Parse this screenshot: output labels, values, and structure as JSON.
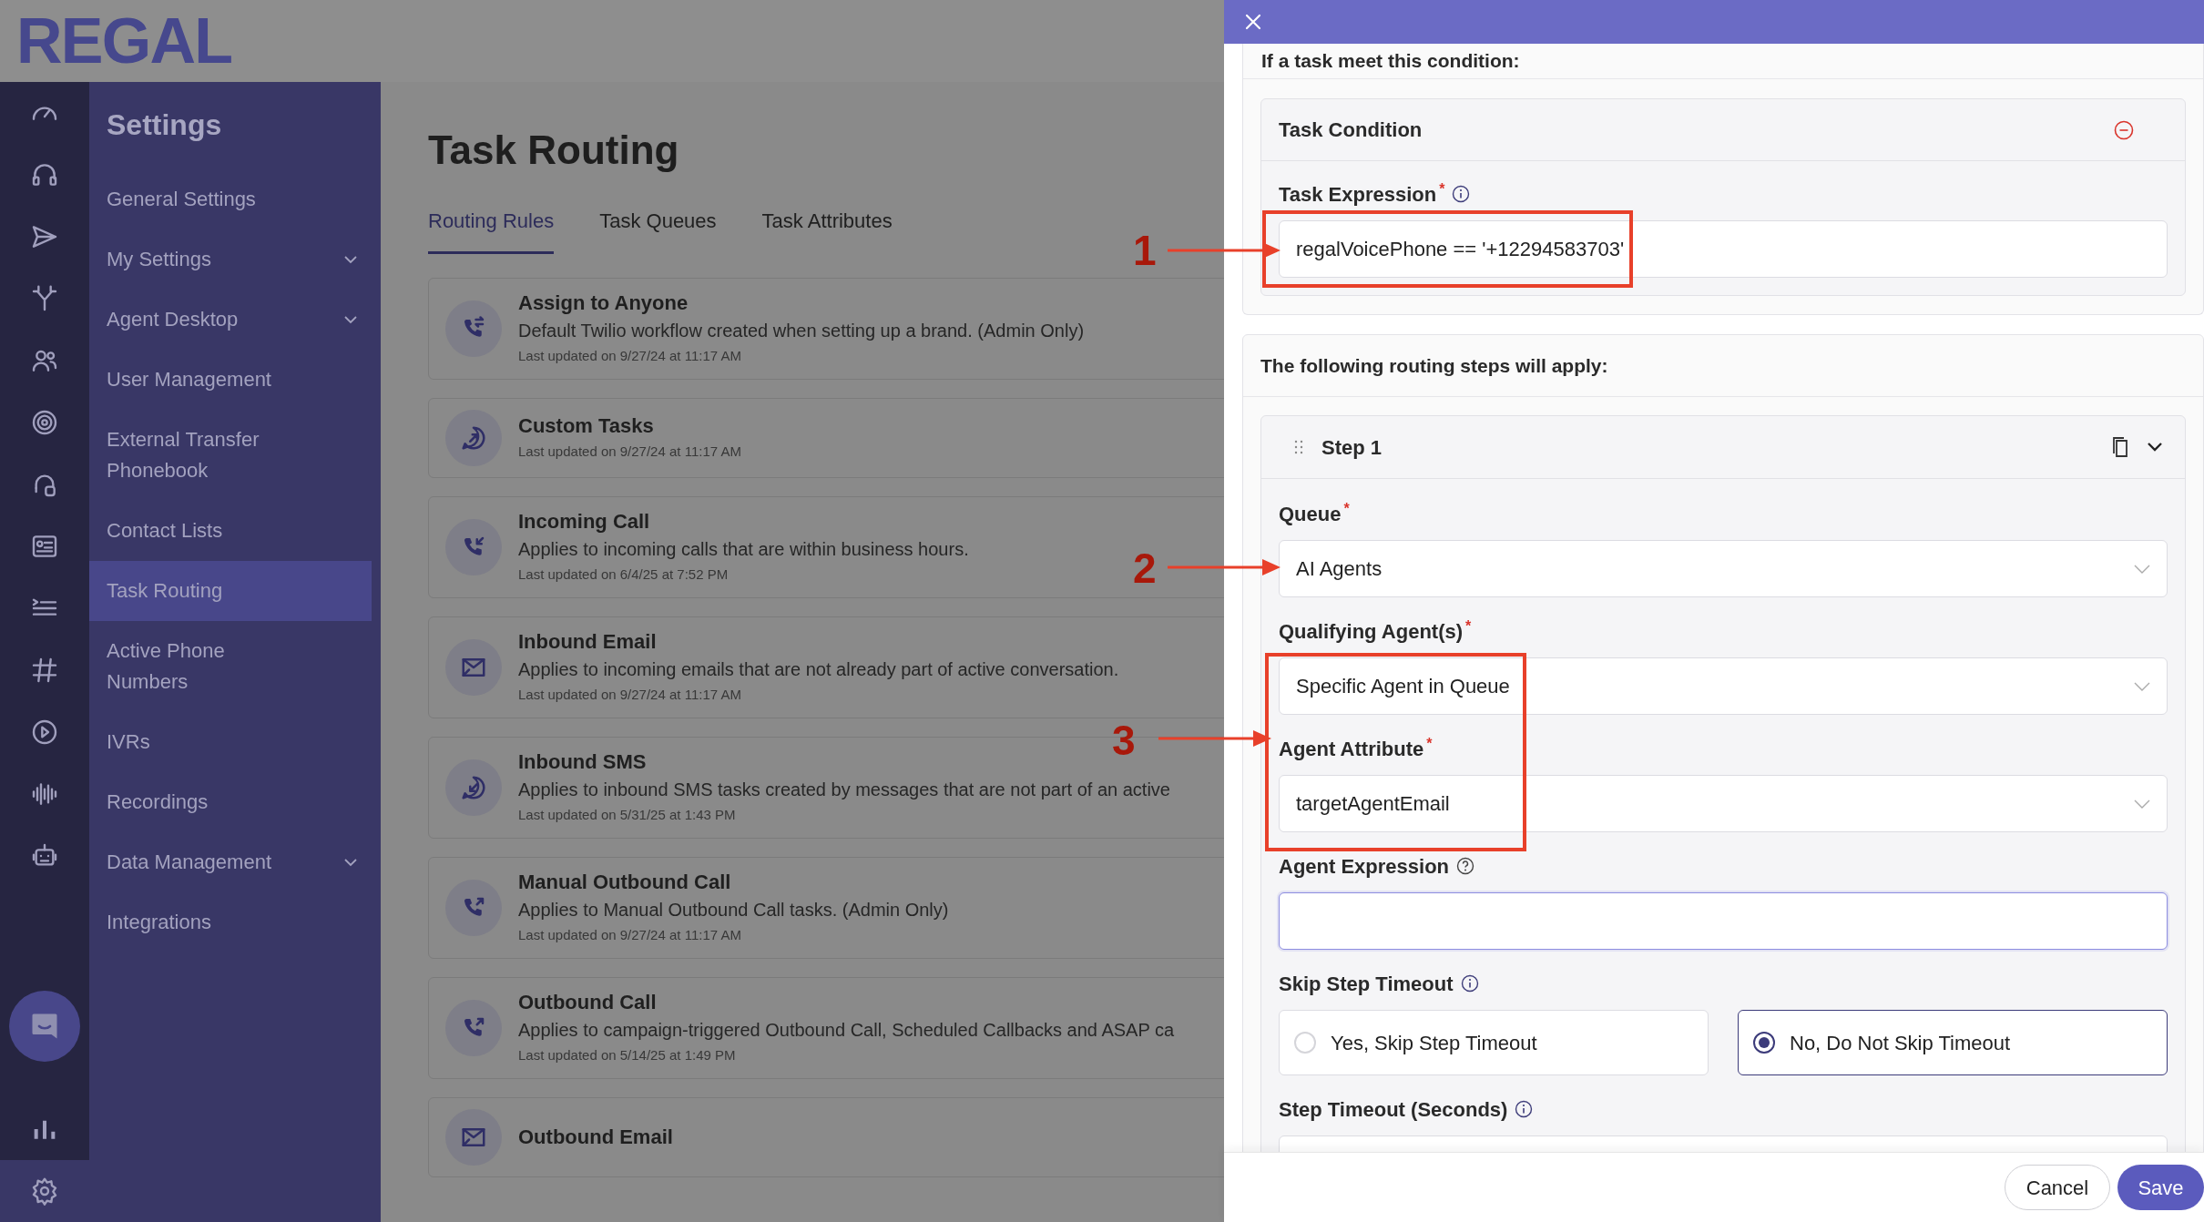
{
  "logo": "REGAL",
  "rail": {
    "top": [
      {
        "selected": false
      },
      {
        "selected": false
      },
      {
        "selected": false
      },
      {
        "selected": false
      },
      {
        "selected": false
      },
      {
        "selected": false
      },
      {
        "selected": false
      },
      {
        "selected": false
      },
      {
        "selected": false
      },
      {
        "selected": false
      },
      {
        "selected": false
      },
      {
        "selected": false
      },
      {
        "selected": false
      }
    ],
    "bottom": [
      {
        "selected": false
      },
      {
        "selected": true
      }
    ]
  },
  "sidebar": {
    "title": "Settings",
    "items": [
      {
        "label": "General Settings",
        "selected": false,
        "has_submenu": false
      },
      {
        "label": "My Settings",
        "selected": false,
        "has_submenu": true
      },
      {
        "label": "Agent Desktop",
        "selected": false,
        "has_submenu": true
      },
      {
        "label": "User Management",
        "selected": false,
        "has_submenu": false
      },
      {
        "label": "External Transfer Phonebook",
        "selected": false,
        "has_submenu": false
      },
      {
        "label": "Contact Lists",
        "selected": false,
        "has_submenu": false
      },
      {
        "label": "Task Routing",
        "selected": true,
        "has_submenu": false
      },
      {
        "label": "Active Phone Numbers",
        "selected": false,
        "has_submenu": false
      },
      {
        "label": "IVRs",
        "selected": false,
        "has_submenu": false
      },
      {
        "label": "Recordings",
        "selected": false,
        "has_submenu": false
      },
      {
        "label": "Data Management",
        "selected": false,
        "has_submenu": true
      },
      {
        "label": "Integrations",
        "selected": false,
        "has_submenu": false
      }
    ]
  },
  "main": {
    "title": "Task Routing",
    "tabs": [
      {
        "label": "Routing Rules",
        "selected": true
      },
      {
        "label": "Task Queues",
        "selected": false
      },
      {
        "label": "Task Attributes",
        "selected": false
      }
    ],
    "rules": [
      {
        "kind": "transfer",
        "title": "Assign to Anyone",
        "description": "Default Twilio workflow created when setting up a brand. (Admin Only)",
        "updated": "Last updated on 9/27/24 at 11:17 AM"
      },
      {
        "kind": "chat-out",
        "title": "Custom Tasks",
        "updated": "Last updated on 9/27/24 at 11:17 AM"
      },
      {
        "kind": "call-in",
        "title": "Incoming Call",
        "description": "Applies to incoming calls that are within business hours.",
        "updated": "Last updated on 6/4/25 at 7:52 PM"
      },
      {
        "kind": "email",
        "title": "Inbound Email",
        "description": "Applies to incoming emails that are not already part of active conversation.",
        "updated": "Last updated on 9/27/24 at 11:17 AM"
      },
      {
        "kind": "chat-in",
        "title": "Inbound SMS",
        "description": "Applies to inbound SMS tasks created by messages that are not part of an active",
        "updated": "Last updated on 5/31/25 at 1:43 PM"
      },
      {
        "kind": "call-out",
        "title": "Manual Outbound Call",
        "description": "Applies to Manual Outbound Call tasks. (Admin Only)",
        "updated": "Last updated on 9/27/24 at 11:17 AM"
      },
      {
        "kind": "call-out",
        "title": "Outbound Call",
        "description": "Applies to campaign-triggered Outbound Call, Scheduled Callbacks and ASAP ca",
        "updated": "Last updated on 5/14/25 at 1:49 PM"
      },
      {
        "kind": "email",
        "title": "Outbound Email"
      }
    ]
  },
  "panel": {
    "condition_heading": "If a task meet this condition:",
    "condition": {
      "title": "Task Condition",
      "field": {
        "kind": "input",
        "label": "Task Expression",
        "required_mark": "*",
        "info_icon": true,
        "value": "regalVoicePhone == '+12294583703'"
      }
    },
    "steps_heading": "The following routing steps will apply:",
    "step": {
      "title": "Step 1",
      "fields": [
        {
          "kind": "select",
          "label": "Queue",
          "required_mark": "*",
          "value": "AI Agents"
        },
        {
          "kind": "select",
          "label": "Qualifying Agent(s)",
          "required_mark": "*",
          "value": "Specific Agent in Queue"
        },
        {
          "kind": "select",
          "label": "Agent Attribute",
          "required_mark": "*",
          "value": "targetAgentEmail"
        },
        {
          "kind": "input",
          "label": "Agent Expression",
          "help_icon": true,
          "focused": true
        },
        {
          "kind": "radio",
          "label": "Skip Step Timeout",
          "info_icon": true,
          "options": [
            {
              "label": "Yes, Skip Step Timeout",
              "selected": false
            },
            {
              "label": "No, Do Not Skip Timeout",
              "selected": true
            }
          ]
        },
        {
          "kind": "input",
          "label": "Step Timeout (Seconds)",
          "info_icon": true,
          "focused": false
        }
      ]
    },
    "buttons": [
      {
        "label": "Cancel",
        "kind": "secondary"
      },
      {
        "label": "Save",
        "kind": "primary"
      }
    ]
  },
  "annotations": [
    {
      "number": "1"
    },
    {
      "number": "2"
    },
    {
      "number": "3"
    }
  ]
}
